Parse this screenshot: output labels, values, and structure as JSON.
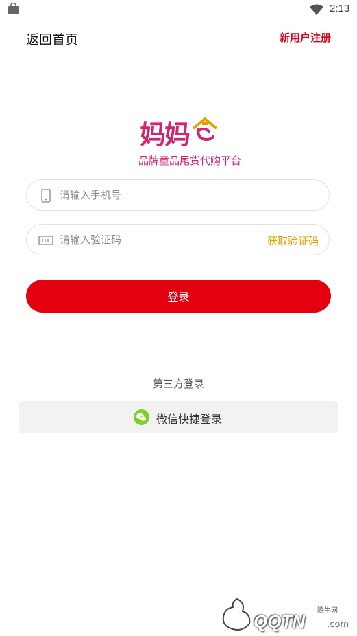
{
  "status_bar": {
    "time": "2:13"
  },
  "nav": {
    "back_label": "返回首页",
    "register_label": "新用户注册"
  },
  "logo": {
    "wordmark": "妈妈",
    "slogan": "品牌童品尾货代购平台"
  },
  "form": {
    "phone_placeholder": "请输入手机号",
    "code_placeholder": "请输入验证码",
    "get_code_label": "获取验证码",
    "login_label": "登录"
  },
  "third_party": {
    "title": "第三方登录",
    "wechat_label": "微信快捷登录"
  },
  "watermark": {
    "top": "腾牛网",
    "main": "QQTN",
    "suffix": ".com"
  },
  "colors": {
    "primary": "#e3000f",
    "accent": "#e5a100",
    "brand": "#d4246b",
    "wechat": "#7ed321"
  },
  "icons": [
    "bag-icon",
    "wifi-icon",
    "battery-icon",
    "phone-icon",
    "keyboard-icon",
    "wechat-icon"
  ]
}
